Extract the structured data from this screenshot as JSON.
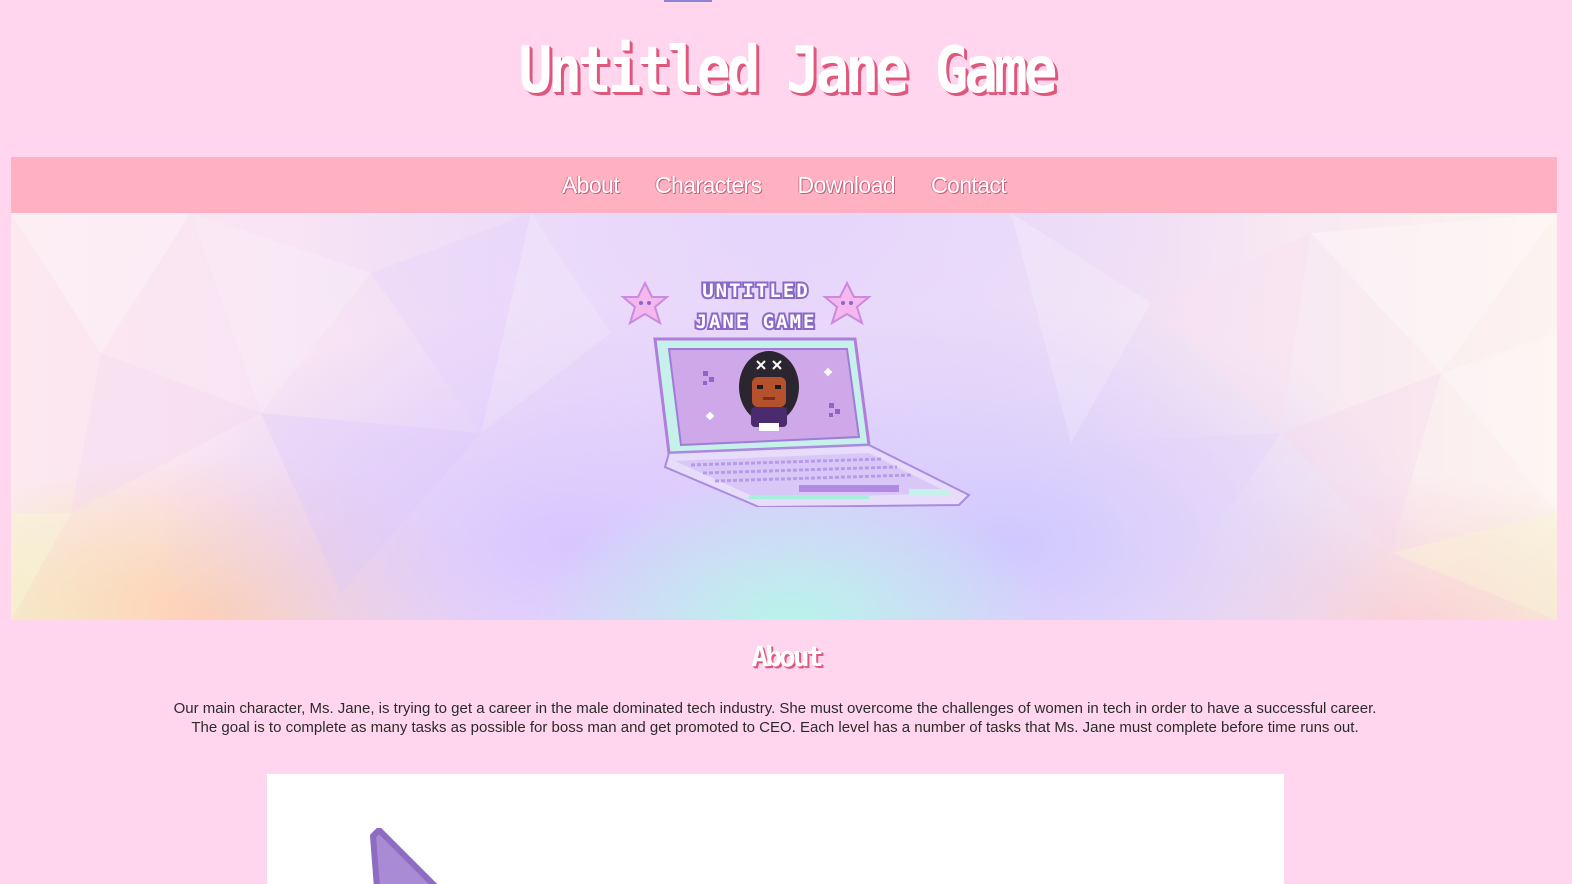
{
  "site": {
    "title": "Untitled Jane Game"
  },
  "nav": {
    "items": [
      {
        "label": "About"
      },
      {
        "label": "Characters"
      },
      {
        "label": "Download"
      },
      {
        "label": "Contact"
      }
    ]
  },
  "hero": {
    "logo_line1": "UNTITLED",
    "logo_line2": "JANE GAME",
    "icons": [
      "star-icon",
      "laptop-icon",
      "character-sprite-icon",
      "sparkle-icon"
    ]
  },
  "about": {
    "heading": "About",
    "paragraph_line1": "Our main character, Ms. Jane, is trying to get a career in the male dominated tech industry. She must overcome the challenges of women in tech in order to have a successful career.",
    "paragraph_line2": "The goal is to complete as many tasks as possible for boss man and get promoted to CEO. Each level has a number of tasks that Ms. Jane must complete before time runs out."
  },
  "colors": {
    "page_background": "#ffd6ee",
    "nav_background": "#ffb1c1",
    "title_shadow": "#e0577d",
    "logo_purple": "#8b68c8"
  }
}
